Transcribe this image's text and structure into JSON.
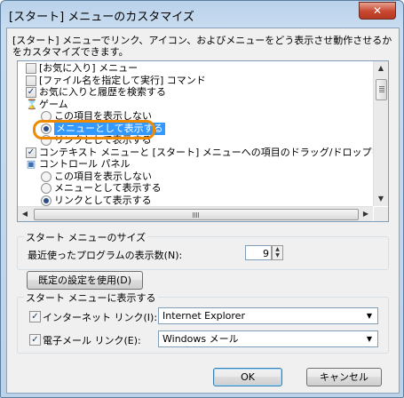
{
  "window": {
    "title": "[スタート] メニューのカスタマイズ",
    "close_symbol": "✕"
  },
  "description": "[スタート] メニューでリンク、アイコン、およびメニューをどう表示させ動作させるかをカスタマイズできます。",
  "list": {
    "items": [
      {
        "kind": "checkbox",
        "checked": false,
        "label": "[お気に入り] メニュー"
      },
      {
        "kind": "checkbox",
        "checked": false,
        "label": "[ファイル名を指定して実行] コマンド"
      },
      {
        "kind": "checkbox",
        "checked": true,
        "label": "お気に入りと履歴を検索する"
      },
      {
        "kind": "header",
        "icon": "game-icon",
        "label": "ゲーム"
      },
      {
        "kind": "radio",
        "checked": false,
        "label": "この項目を表示しない"
      },
      {
        "kind": "radio",
        "checked": true,
        "label": "メニューとして表示する",
        "selected": true
      },
      {
        "kind": "radio",
        "checked": false,
        "label": "リンクとして表示する"
      },
      {
        "kind": "checkbox",
        "checked": true,
        "label": "コンテキスト メニューと [スタート] メニューへの項目のドラッグ/ドロップを有効化する"
      },
      {
        "kind": "header",
        "icon": "control-panel-icon",
        "label": "コントロール パネル"
      },
      {
        "kind": "radio",
        "checked": false,
        "label": "この項目を表示しない"
      },
      {
        "kind": "radio",
        "checked": false,
        "label": "メニューとして表示する"
      },
      {
        "kind": "radio",
        "checked": true,
        "label": "リンクとして表示する"
      }
    ]
  },
  "size_group": {
    "title": "スタート メニューのサイズ",
    "recent_programs_label": "最近使ったプログラムの表示数(N):",
    "recent_programs_value": "9"
  },
  "defaults_button": "既定の設定を使用(D)",
  "show_group": {
    "title": "スタート メニューに表示する",
    "internet_label": "インターネット リンク(I):",
    "internet_checked": true,
    "internet_value": "Internet Explorer",
    "email_label": "電子メール リンク(E):",
    "email_checked": true,
    "email_value": "Windows メール"
  },
  "buttons": {
    "ok": "OK",
    "cancel": "キャンセル"
  }
}
